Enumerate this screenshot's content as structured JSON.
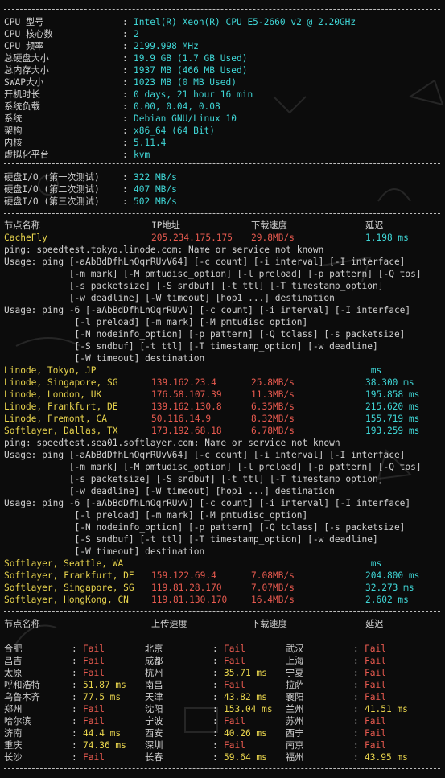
{
  "colors": {
    "white": "#d0d0d0",
    "cyan": "#3fd6d6",
    "yellow": "#e8d44d",
    "red": "#e85a4f",
    "green": "#7ad36b"
  },
  "system_info": [
    {
      "label": "CPU 型号",
      "value": "Intel(R) Xeon(R) CPU E5-2660 v2 @ 2.20GHz"
    },
    {
      "label": "CPU 核心数",
      "value": "2"
    },
    {
      "label": "CPU 频率",
      "value": "2199.998 MHz"
    },
    {
      "label": "总硬盘大小",
      "value": "19.9 GB (1.7 GB Used)"
    },
    {
      "label": "总内存大小",
      "value": "1937 MB (466 MB Used)"
    },
    {
      "label": "SWAP大小",
      "value": "1023 MB (0 MB Used)"
    },
    {
      "label": "开机时长",
      "value": "0 days, 21 hour 16 min"
    },
    {
      "label": "系统负载",
      "value": "0.00, 0.04, 0.08"
    },
    {
      "label": "系统",
      "value": "Debian GNU/Linux 10"
    },
    {
      "label": "架构",
      "value": "x86_64 (64 Bit)"
    },
    {
      "label": "内核",
      "value": "5.11.4"
    },
    {
      "label": "虚拟化平台",
      "value": "kvm"
    }
  ],
  "disk_io": [
    {
      "label": "硬盘I/O (第一次测试)",
      "value": "322 MB/s"
    },
    {
      "label": "硬盘I/O (第二次测试)",
      "value": "407 MB/s"
    },
    {
      "label": "硬盘I/O (第三次测试)",
      "value": "502 MB/s"
    }
  ],
  "download_header": {
    "node": "节点名称",
    "ip": "IP地址",
    "speed": "下载速度",
    "latency": "延迟"
  },
  "download_lines": [
    {
      "node": "CacheFly",
      "ip": "205.234.175.175",
      "speed": "29.8MB/s",
      "latency": "1.198 ms"
    },
    {
      "text": "ping: speedtest.tokyo.linode.com: Name or service not known"
    },
    {
      "text": "Usage: ping [-aAbBdDfhLnOqrRUvV64] [-c count] [-i interval] [-I interface]"
    },
    {
      "text": "            [-m mark] [-M pmtudisc_option] [-l preload] [-p pattern] [-Q tos]"
    },
    {
      "text": "            [-s packetsize] [-S sndbuf] [-t ttl] [-T timestamp_option]"
    },
    {
      "text": "            [-w deadline] [-W timeout] [hop1 ...] destination"
    },
    {
      "text": "Usage: ping -6 [-aAbBdDfhLnOqrRUvV] [-c count] [-i interval] [-I interface]"
    },
    {
      "text": "             [-l preload] [-m mark] [-M pmtudisc_option]"
    },
    {
      "text": "             [-N nodeinfo_option] [-p pattern] [-Q tclass] [-s packetsize]"
    },
    {
      "text": "             [-S sndbuf] [-t ttl] [-T timestamp_option] [-w deadline]"
    },
    {
      "text": "             [-W timeout] destination"
    },
    {
      "node": "Linode, Tokyo, JP",
      "ip": "",
      "speed": "",
      "latency": " ms"
    },
    {
      "node": "Linode, Singapore, SG",
      "ip": "139.162.23.4",
      "speed": "25.8MB/s",
      "latency": "38.300 ms"
    },
    {
      "node": "Linode, London, UK",
      "ip": "176.58.107.39",
      "speed": "11.3MB/s",
      "latency": "195.858 ms"
    },
    {
      "node": "Linode, Frankfurt, DE",
      "ip": "139.162.130.8",
      "speed": "6.35MB/s",
      "latency": "215.620 ms"
    },
    {
      "node": "Linode, Fremont, CA",
      "ip": "50.116.14.9",
      "speed": "8.32MB/s",
      "latency": "155.719 ms"
    },
    {
      "node": "Softlayer, Dallas, TX",
      "ip": "173.192.68.18",
      "speed": "6.78MB/s",
      "latency": "193.259 ms"
    },
    {
      "text": "ping: speedtest.sea01.softlayer.com: Name or service not known"
    },
    {
      "text": "Usage: ping [-aAbBdDfhLnOqrRUvV64] [-c count] [-i interval] [-I interface]"
    },
    {
      "text": "            [-m mark] [-M pmtudisc_option] [-l preload] [-p pattern] [-Q tos]"
    },
    {
      "text": "            [-s packetsize] [-S sndbuf] [-t ttl] [-T timestamp_option]"
    },
    {
      "text": "            [-w deadline] [-W timeout] [hop1 ...] destination"
    },
    {
      "text": "Usage: ping -6 [-aAbBdDfhLnOqrRUvV] [-c count] [-i interval] [-I interface]"
    },
    {
      "text": "             [-l preload] [-m mark] [-M pmtudisc_option]"
    },
    {
      "text": "             [-N nodeinfo_option] [-p pattern] [-Q tclass] [-s packetsize]"
    },
    {
      "text": "             [-S sndbuf] [-t ttl] [-T timestamp_option] [-w deadline]"
    },
    {
      "text": "             [-W timeout] destination"
    },
    {
      "node": "Softlayer, Seattle, WA",
      "ip": "",
      "speed": "",
      "latency": " ms"
    },
    {
      "node": "Softlayer, Frankfurt, DE",
      "ip": "159.122.69.4",
      "speed": "7.08MB/s",
      "latency": "204.800 ms"
    },
    {
      "node": "Softlayer, Singapore, SG",
      "ip": "119.81.28.170",
      "speed": "7.07MB/s",
      "latency": "32.273 ms"
    },
    {
      "node": "Softlayer, HongKong, CN",
      "ip": "119.81.130.170",
      "speed": "16.4MB/s",
      "latency": "2.602 ms"
    }
  ],
  "upload_header": {
    "node": "节点名称",
    "upload": "上传速度",
    "download": "下载速度",
    "latency": "延迟"
  },
  "ping_rows": [
    [
      {
        "city": "合肥",
        "value": "Fail"
      },
      {
        "city": "北京",
        "value": "Fail"
      },
      {
        "city": "武汉",
        "value": "Fail"
      }
    ],
    [
      {
        "city": "昌吉",
        "value": "Fail"
      },
      {
        "city": "成都",
        "value": "Fail"
      },
      {
        "city": "上海",
        "value": "Fail"
      }
    ],
    [
      {
        "city": "太原",
        "value": "Fail"
      },
      {
        "city": "杭州",
        "value": "35.71 ms"
      },
      {
        "city": "宁夏",
        "value": "Fail"
      }
    ],
    [
      {
        "city": "呼和浩特",
        "value": "51.87 ms"
      },
      {
        "city": "南昌",
        "value": "Fail"
      },
      {
        "city": "拉萨",
        "value": "Fail"
      }
    ],
    [
      {
        "city": "乌鲁木齐",
        "value": "77.5 ms"
      },
      {
        "city": "天津",
        "value": "43.82 ms"
      },
      {
        "city": "襄阳",
        "value": "Fail"
      }
    ],
    [
      {
        "city": "郑州",
        "value": "Fail"
      },
      {
        "city": "沈阳",
        "value": "153.04 ms"
      },
      {
        "city": "兰州",
        "value": "41.51 ms"
      }
    ],
    [
      {
        "city": "哈尔滨",
        "value": "Fail"
      },
      {
        "city": "宁波",
        "value": "Fail"
      },
      {
        "city": "苏州",
        "value": "Fail"
      }
    ],
    [
      {
        "city": "济南",
        "value": "44.4 ms"
      },
      {
        "city": "西安",
        "value": "40.26 ms"
      },
      {
        "city": "西宁",
        "value": "Fail"
      }
    ],
    [
      {
        "city": "重庆",
        "value": "74.36 ms"
      },
      {
        "city": "深圳",
        "value": "Fail"
      },
      {
        "city": "南京",
        "value": "Fail"
      }
    ],
    [
      {
        "city": "长沙",
        "value": "Fail"
      },
      {
        "city": "长春",
        "value": "59.64 ms"
      },
      {
        "city": "福州",
        "value": "43.95 ms"
      }
    ]
  ]
}
